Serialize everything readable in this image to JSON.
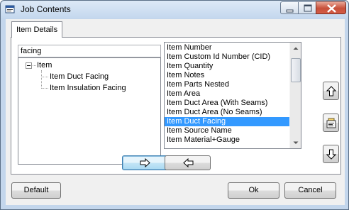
{
  "window": {
    "title": "Job Contents",
    "controls": {
      "minimize": "minimize-icon",
      "maximize": "maximize-icon",
      "close": "close-icon"
    }
  },
  "tabs": [
    {
      "label": "Item Details",
      "active": true
    }
  ],
  "search": {
    "value": "facing"
  },
  "tree": {
    "root": {
      "label": "Item",
      "expanded": true
    },
    "children": [
      "Item Duct Facing",
      "Item Insulation Facing"
    ]
  },
  "fields_list": {
    "items": [
      "Item Number",
      "Item Custom Id Number (CID)",
      "Item Quantity",
      "Item Notes",
      "Item Parts Nested",
      "Item Area",
      "Item Duct Area (With Seams)",
      "Item Duct Area (No Seams)",
      "Item Duct Facing",
      "Item Source Name",
      "Item Material+Gauge"
    ],
    "selected": "Item Duct Facing"
  },
  "side_buttons": {
    "up": "arrow-up-icon",
    "properties": "properties-icon",
    "down": "arrow-down-icon"
  },
  "move_buttons": {
    "add": "arrow-right-icon",
    "remove": "arrow-left-icon"
  },
  "buttons": {
    "default": "Default",
    "ok": "Ok",
    "cancel": "Cancel"
  },
  "colors": {
    "selection": "#3399ff",
    "titlebar": "#c5d8ee",
    "close_button": "#c7503a"
  }
}
